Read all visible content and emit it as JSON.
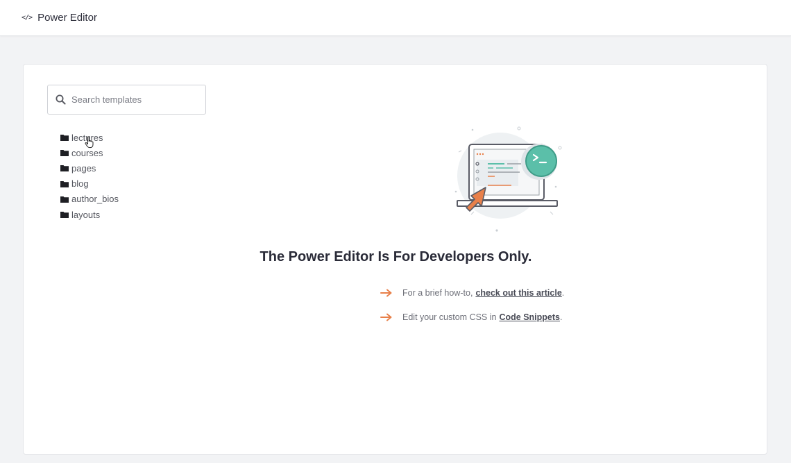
{
  "header": {
    "icon": "code-icon",
    "title": "Power Editor"
  },
  "search": {
    "icon": "search-icon",
    "placeholder": "Search templates",
    "value": ""
  },
  "folders": [
    {
      "icon": "folder-icon",
      "label": "lectures"
    },
    {
      "icon": "folder-icon",
      "label": "courses"
    },
    {
      "icon": "folder-icon",
      "label": "pages"
    },
    {
      "icon": "folder-icon",
      "label": "blog"
    },
    {
      "icon": "folder-icon",
      "label": "author_bios"
    },
    {
      "icon": "folder-icon",
      "label": "layouts"
    }
  ],
  "main": {
    "illustration": "laptop-terminal-illustration",
    "headline": "The Power Editor Is For Developers Only.",
    "tips": [
      {
        "icon": "arrow-right-icon",
        "prefix": "For a brief how-to,",
        "link": "check out this article",
        "suffix": "."
      },
      {
        "icon": "arrow-right-icon",
        "prefix": "Edit your custom CSS in",
        "link": "Code Snippets",
        "suffix": "."
      }
    ]
  },
  "colors": {
    "accent_orange": "#e8804a",
    "accent_teal": "#5bbfa9",
    "text_dark": "#2c2d3a",
    "background": "#f2f3f5"
  }
}
